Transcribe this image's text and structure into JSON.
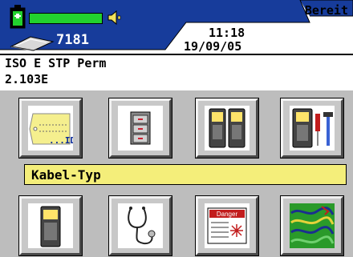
{
  "status": {
    "text": "Bereit",
    "battery_level": 1.0,
    "memory_count": "7181",
    "time": "11:18",
    "date": "19/09/05",
    "colors": {
      "header": "#173c9b",
      "battery_fill": "#22d22e",
      "selection_bar": "#f4ee7a"
    }
  },
  "test_info": {
    "standard": "ISO E STP Perm",
    "version": "2.103E"
  },
  "menu": {
    "selected_label": "Kabel-Typ",
    "tiles": [
      {
        "icon": "cable-id-tag-icon",
        "caption": "...ID"
      },
      {
        "icon": "file-cabinet-icon"
      },
      {
        "icon": "two-testers-icon"
      },
      {
        "icon": "tester-tools-icon"
      },
      {
        "icon": "tester-device-icon"
      },
      {
        "icon": "stethoscope-icon"
      },
      {
        "icon": "danger-sign-icon",
        "sign_text": "Danger"
      },
      {
        "icon": "cable-map-icon"
      }
    ]
  }
}
